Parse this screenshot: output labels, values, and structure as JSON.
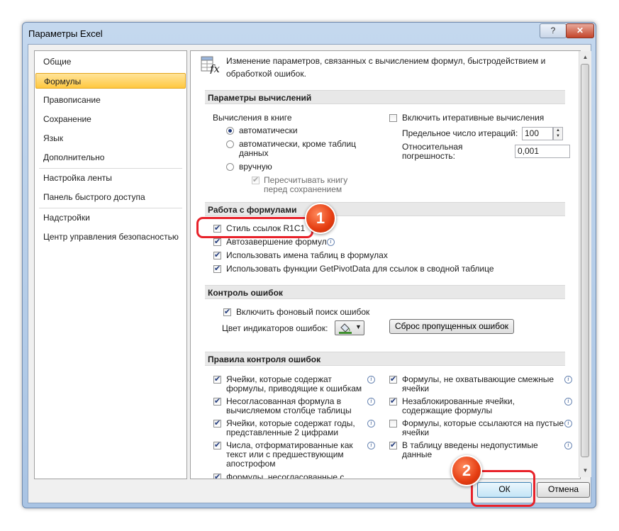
{
  "window": {
    "title": "Параметры Excel",
    "help_label": "?",
    "close_label": "✕"
  },
  "nav": {
    "items": [
      "Общие",
      "Формулы",
      "Правописание",
      "Сохранение",
      "Язык",
      "Дополнительно",
      "Настройка ленты",
      "Панель быстрого доступа",
      "Надстройки",
      "Центр управления безопасностью"
    ],
    "active_index": 1
  },
  "header": {
    "line1": "Изменение параметров, связанных с вычислением формул, быстродействием и",
    "line2": "обработкой ошибок."
  },
  "calc": {
    "section_title": "Параметры вычислений",
    "workbook_label": "Вычисления в книге",
    "auto_label": "автоматически",
    "auto_except_line1": "автоматически, кроме таблиц",
    "auto_except_line2": "данных",
    "manual_label": "вручную",
    "recalc_line1": "Пересчитывать книгу",
    "recalc_line2": "перед сохранением",
    "selected_mode": "автоматически",
    "iterative_label": "Включить итеративные вычисления",
    "iterative_checked": false,
    "max_iter_label": "Предельное число итераций:",
    "max_iter_value": "100",
    "max_change_line1": "Относительная",
    "max_change_line2": "погрешность:",
    "max_change_value": "0,001"
  },
  "formulas": {
    "section_title": "Работа с формулами",
    "r1c1_label": "Стиль ссылок R1C1",
    "autocomplete_label": "Автозавершение формул",
    "table_names_label": "Использовать имена таблиц в формулах",
    "getpivot_label": "Использовать функции GetPivotData для ссылок в сводной таблице"
  },
  "errors": {
    "section_title": "Контроль ошибок",
    "background_label": "Включить фоновый поиск ошибок",
    "indicator_label": "Цвет индикаторов ошибок:",
    "reset_label": "Сброс пропущенных ошибок"
  },
  "rules": {
    "section_title": "Правила контроля ошибок",
    "left": [
      {
        "line1": "Ячейки, которые содержат",
        "line2": "формулы, приводящие к ошибкам",
        "checked": true
      },
      {
        "line1": "Несогласованная формула в",
        "line2": "вычисляемом столбце таблицы",
        "checked": true
      },
      {
        "line1": "Ячейки, которые содержат годы,",
        "line2": "представленные 2 цифрами",
        "checked": true
      },
      {
        "line1": "Числа, отформатированные как",
        "line2": "текст или с предшествующим",
        "line3": "апострофом",
        "checked": true
      },
      {
        "line1": "Формулы, несогласованные с",
        "checked": true
      }
    ],
    "right": [
      {
        "line1": "Формулы, не охватывающие смежные",
        "line2": "ячейки",
        "checked": true
      },
      {
        "line1": "Незаблокированные ячейки,",
        "line2": "содержащие формулы",
        "checked": true
      },
      {
        "line1": "Формулы, которые ссылаются на пустые",
        "line2": "ячейки",
        "checked": false
      },
      {
        "line1": "В таблицу введены недопустимые",
        "line2": "данные",
        "checked": true
      }
    ]
  },
  "footer": {
    "ok_label": "ОК",
    "cancel_label": "Отмена"
  },
  "callouts": {
    "badge1": "1",
    "badge2": "2",
    "color": "#e8222a"
  },
  "colors": {
    "accent": "#ffc840",
    "check": "#213a7c"
  }
}
